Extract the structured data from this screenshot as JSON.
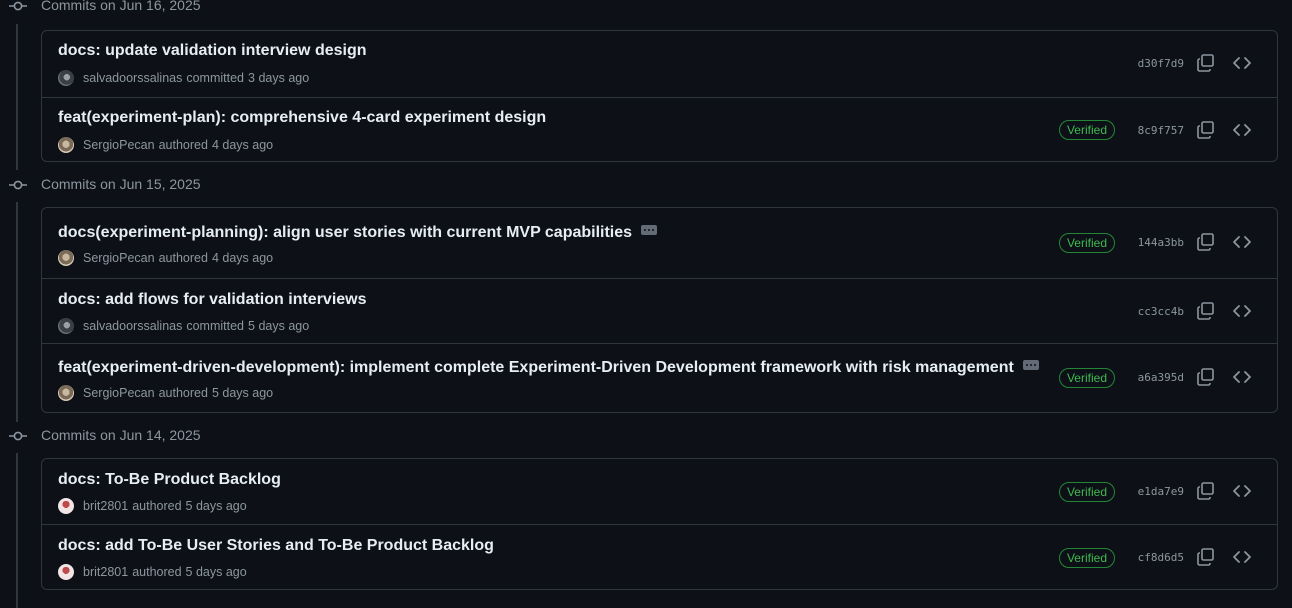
{
  "groups": [
    {
      "label": "Commits on Jun 16, 2025",
      "commits": [
        {
          "title": "docs: update validation interview design",
          "author": "salvadoorssalinas",
          "action": "committed",
          "when": "3 days ago",
          "verified": false,
          "sha": "d30f7d9",
          "avatar": "salva",
          "ellipsis": false
        },
        {
          "title": "feat(experiment-plan): comprehensive 4-card experiment design",
          "author": "SergioPecan",
          "action": "authored",
          "when": "4 days ago",
          "verified": true,
          "sha": "8c9f757",
          "avatar": "sergio",
          "ellipsis": false
        }
      ]
    },
    {
      "label": "Commits on Jun 15, 2025",
      "commits": [
        {
          "title": "docs(experiment-planning): align user stories with current MVP capabilities",
          "author": "SergioPecan",
          "action": "authored",
          "when": "4 days ago",
          "verified": true,
          "sha": "144a3bb",
          "avatar": "sergio",
          "ellipsis": true
        },
        {
          "title": "docs: add flows for validation interviews",
          "author": "salvadoorssalinas",
          "action": "committed",
          "when": "5 days ago",
          "verified": false,
          "sha": "cc3cc4b",
          "avatar": "salva",
          "ellipsis": false
        },
        {
          "title": "feat(experiment-driven-development): implement complete Experiment-Driven Development framework with risk management",
          "author": "SergioPecan",
          "action": "authored",
          "when": "5 days ago",
          "verified": true,
          "sha": "a6a395d",
          "avatar": "sergio",
          "ellipsis": true
        }
      ]
    },
    {
      "label": "Commits on Jun 14, 2025",
      "commits": [
        {
          "title": "docs: To-Be Product Backlog",
          "author": "brit2801",
          "action": "authored",
          "when": "5 days ago",
          "verified": true,
          "sha": "e1da7e9",
          "avatar": "brit",
          "ellipsis": false
        },
        {
          "title": "docs: add To-Be User Stories and To-Be Product Backlog",
          "author": "brit2801",
          "action": "authored",
          "when": "5 days ago",
          "verified": true,
          "sha": "cf8d6d5",
          "avatar": "brit",
          "ellipsis": false
        }
      ]
    }
  ],
  "labels": {
    "verified": "Verified"
  },
  "icons": {
    "commit": "git-commit-icon",
    "copy": "copy-icon",
    "browse": "code-icon",
    "more": "ellipsis-icon"
  },
  "colors": {
    "background": "#0d1117",
    "border": "#30363d",
    "text": "#e6edf3",
    "muted": "#8d96a0",
    "verified": "#3fb950"
  }
}
